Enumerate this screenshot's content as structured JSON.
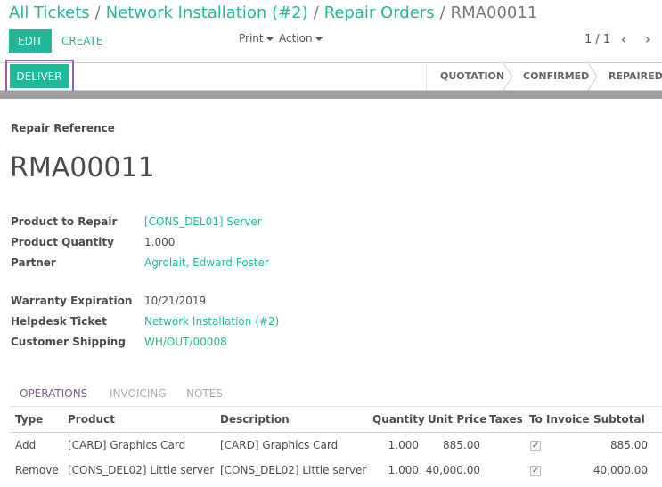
{
  "breadcrumb": {
    "items": [
      "All Tickets",
      "Network Installation (#2)",
      "Repair Orders"
    ],
    "active": "RMA00011",
    "separator": "/"
  },
  "toolbar": {
    "edit_label": "EDIT",
    "create_label": "CREATE",
    "print_label": "Print",
    "action_label": "Action"
  },
  "pager": {
    "value": "1 / 1",
    "prev_icon": "‹",
    "next_icon": "›"
  },
  "statusbar": {
    "deliver_label": "DELIVER",
    "stages": [
      "QUOTATION",
      "CONFIRMED",
      "REPAIRED"
    ]
  },
  "form": {
    "reference_label": "Repair Reference",
    "reference_value": "RMA00011",
    "fields": [
      {
        "label": "Product to Repair",
        "value": "[CONS_DEL01] Server",
        "link": true
      },
      {
        "label": "Product Quantity",
        "value": "1.000",
        "link": false
      },
      {
        "label": "Partner",
        "value": "Agrolait, Edward Foster",
        "link": true
      },
      {
        "label": "Warranty Expiration",
        "value": "10/21/2019",
        "link": false
      },
      {
        "label": "Helpdesk Ticket",
        "value": "Network Installation (#2)",
        "link": true
      },
      {
        "label": "Customer Shipping",
        "value": "WH/OUT/00008",
        "link": true
      }
    ]
  },
  "tabs": {
    "items": [
      "OPERATIONS",
      "INVOICING",
      "NOTES"
    ],
    "active_index": 0
  },
  "operations_table": {
    "headers": [
      "Type",
      "Product",
      "Description",
      "Quantity",
      "Unit Price",
      "Taxes",
      "To Invoice",
      "Subtotal"
    ],
    "rows": [
      {
        "type": "Add",
        "product": "[CARD] Graphics Card",
        "description": "[CARD] Graphics Card",
        "quantity": "1.000",
        "unit_price": "885.00",
        "taxes": "",
        "to_invoice": true,
        "subtotal": "885.00"
      },
      {
        "type": "Remove",
        "product": "[CONS_DEL02] Little server",
        "description": "[CONS_DEL02] Little server",
        "quantity": "1.000",
        "unit_price": "40,000.00",
        "taxes": "",
        "to_invoice": true,
        "subtotal": "40,000.00"
      }
    ]
  },
  "colors": {
    "accent": "#21b799",
    "highlight_border": "#9b59b6",
    "active_tab": "#7c5b8a"
  },
  "icons": {
    "caret": "caret-down-icon",
    "check": "✔"
  }
}
